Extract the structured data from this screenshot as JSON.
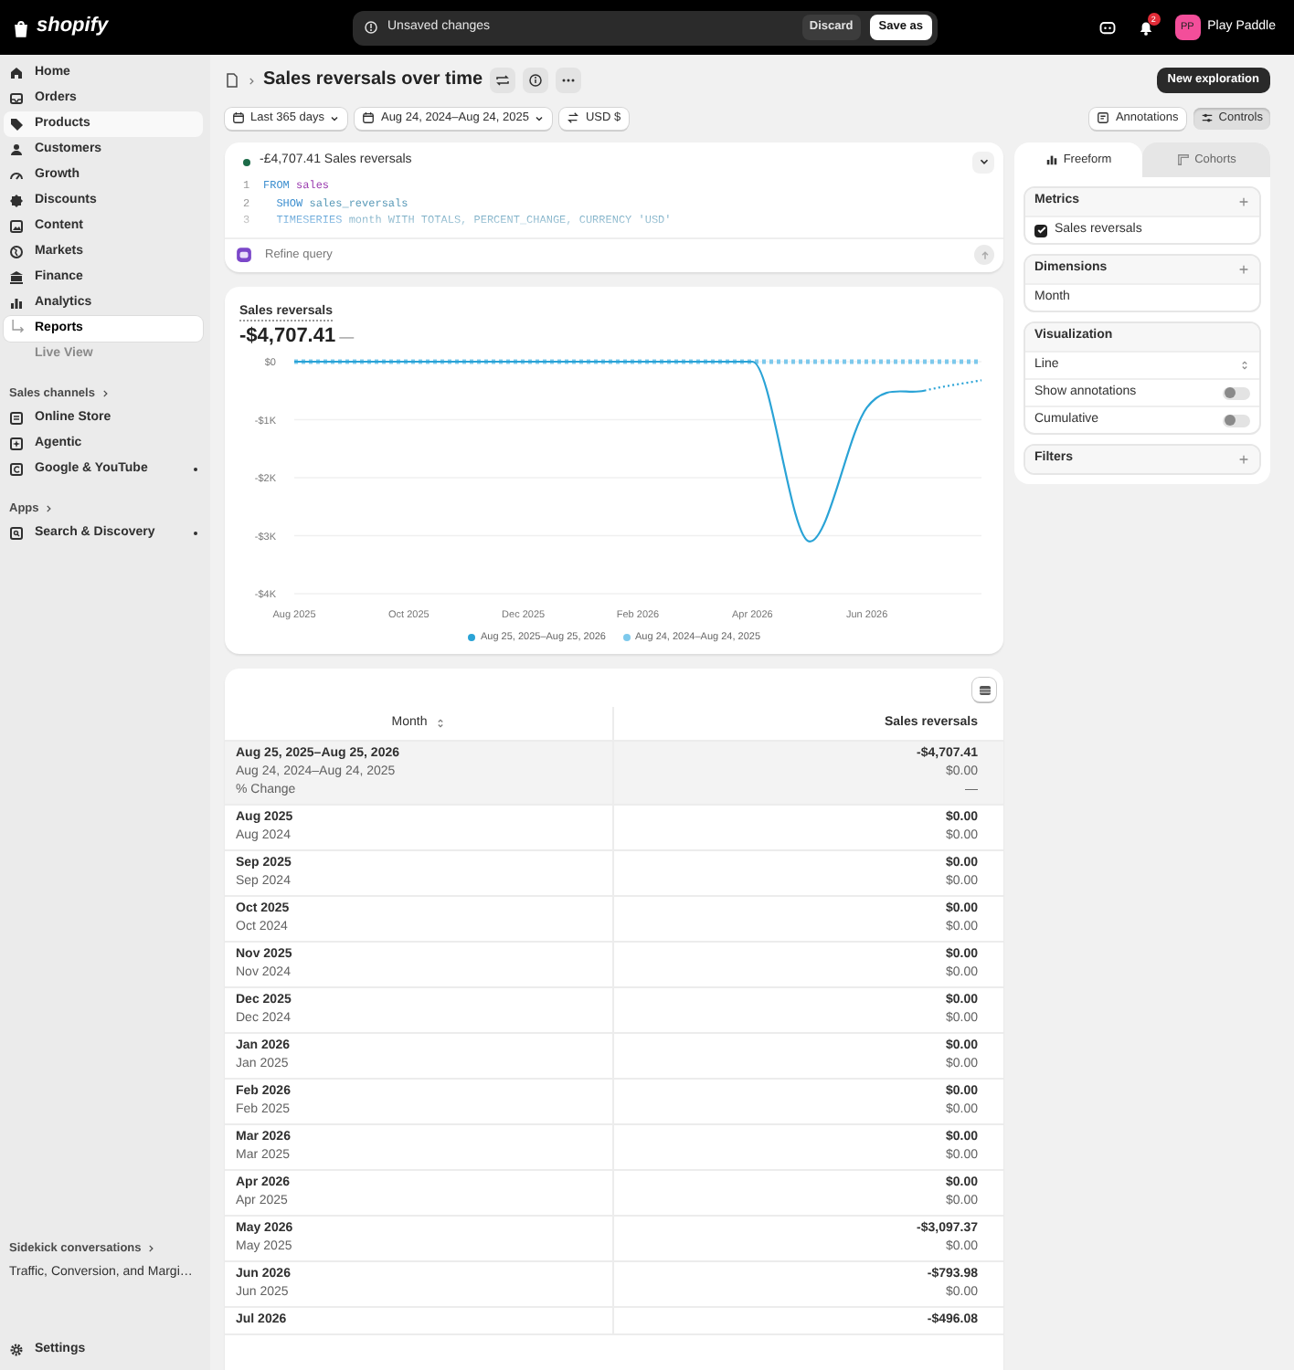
{
  "topbar": {
    "logo": "shopify",
    "alert": "Unsaved changes",
    "discard": "Discard",
    "save": "Save as",
    "notification_count": "2",
    "avatar_initials": "PP",
    "store_name": "Play Paddle"
  },
  "sidebar": {
    "items": [
      {
        "label": "Home",
        "selected": false,
        "highlighted": false
      },
      {
        "label": "Orders",
        "selected": false,
        "highlighted": false
      },
      {
        "label": "Products",
        "selected": false,
        "highlighted": true
      },
      {
        "label": "Customers",
        "selected": false,
        "highlighted": false
      },
      {
        "label": "Growth",
        "selected": false,
        "highlighted": false
      },
      {
        "label": "Discounts",
        "selected": false,
        "highlighted": false
      },
      {
        "label": "Content",
        "selected": false,
        "highlighted": false
      },
      {
        "label": "Markets",
        "selected": false,
        "highlighted": false
      },
      {
        "label": "Finance",
        "selected": false,
        "highlighted": false
      },
      {
        "label": "Analytics",
        "selected": false,
        "highlighted": false,
        "children": [
          {
            "label": "Reports",
            "selected": true
          },
          {
            "label": "Live View",
            "selected": false
          }
        ]
      }
    ],
    "sections": [
      {
        "title": "Sales channels",
        "items": [
          {
            "label": "Online Store",
            "dot": false
          },
          {
            "label": "Agentic",
            "dot": false
          },
          {
            "label": "Google & YouTube",
            "dot": true
          }
        ]
      },
      {
        "title": "Apps",
        "items": [
          {
            "label": "Search & Discovery",
            "dot": true
          }
        ]
      }
    ],
    "conversations": {
      "title": "Sidekick conversations",
      "items": [
        "Traffic, Conversion, and Margi…"
      ]
    },
    "settings": "Settings"
  },
  "header": {
    "title": "Sales reversals over time",
    "new_button": "New exploration",
    "filters": [
      {
        "label": "Last 365 days",
        "caret": true
      },
      {
        "label": "Aug 24, 2024–Aug 24, 2025",
        "caret": true
      },
      {
        "label": "USD $",
        "caret": false
      }
    ],
    "toggles": [
      {
        "label": "Annotations",
        "selected": false
      },
      {
        "label": "Controls",
        "selected": true
      }
    ]
  },
  "query": {
    "summary": "-£4,707.41 Sales reversals",
    "refine_placeholder": "Refine query",
    "code": [
      {
        "number": "1",
        "keyword": "FROM",
        "rest": "sales"
      },
      {
        "number": "2",
        "keyword": "  SHOW",
        "rest": "sales_reversals"
      },
      {
        "number": "3",
        "keyword": "  TIMESERIES",
        "rest": "month WITH TOTALS, PERCENT_CHANGE, CURRENCY 'USD'"
      }
    ]
  },
  "chart_card": {
    "title": "Sales reversals",
    "total": "-$4,707.41",
    "change": "—",
    "chart_data": {
      "type": "line",
      "categories": [
        "Aug 2025",
        null,
        "Oct 2025",
        null,
        "Dec 2025",
        null,
        "Feb 2026",
        null,
        "Apr 2026",
        null,
        "Jun 2026",
        null,
        null
      ],
      "ylim": [
        -4000,
        0
      ],
      "grid": true,
      "yticks": [
        {
          "value": 0,
          "label": "$0"
        },
        {
          "value": -1000,
          "label": "-$1K"
        },
        {
          "value": -2000,
          "label": "-$2K"
        },
        {
          "value": -3000,
          "label": "-$3K"
        },
        {
          "value": -4000,
          "label": "-$4K"
        }
      ],
      "series": [
        {
          "name": "Aug 25, 2025–Aug 25, 2026",
          "color": "#2aa3d6",
          "line_style": "solid_then_dotted",
          "values": [
            0,
            0,
            0,
            0,
            0,
            0,
            0,
            0,
            0,
            -3100,
            -790,
            -500,
            -320
          ]
        },
        {
          "name": "Aug 24, 2024–Aug 24, 2025",
          "color": "#7dc9ec",
          "line_style": "dashed",
          "values": [
            0,
            0,
            0,
            0,
            0,
            0,
            0,
            0,
            0,
            0,
            0,
            0,
            0
          ]
        }
      ]
    }
  },
  "panel": {
    "tabs": [
      {
        "label": "Freeform",
        "selected": true
      },
      {
        "label": "Cohorts",
        "selected": false
      }
    ],
    "metrics": {
      "title": "Metrics",
      "items": [
        {
          "label": "Sales reversals",
          "checked": true
        }
      ]
    },
    "dimensions": {
      "title": "Dimensions",
      "items": [
        "Month"
      ]
    },
    "visualization": {
      "title": "Visualization",
      "type": "Line",
      "toggles": [
        {
          "label": "Show annotations",
          "on": false
        },
        {
          "label": "Cumulative",
          "on": false
        }
      ]
    },
    "filters": {
      "title": "Filters"
    }
  },
  "table": {
    "columns": [
      "Month",
      "Sales reversals"
    ],
    "summary": {
      "current_range": "Aug 25, 2025–Aug 25, 2026",
      "previous_range": "Aug 24, 2024–Aug 24, 2025",
      "change_label": "% Change",
      "current_value": "-$4,707.41",
      "previous_value": "$0.00",
      "change_value": "—"
    },
    "rows": [
      {
        "current": "Aug 2025",
        "previous": "Aug 2024",
        "value": "$0.00",
        "previous_value": "$0.00"
      },
      {
        "current": "Sep 2025",
        "previous": "Sep 2024",
        "value": "$0.00",
        "previous_value": "$0.00"
      },
      {
        "current": "Oct 2025",
        "previous": "Oct 2024",
        "value": "$0.00",
        "previous_value": "$0.00"
      },
      {
        "current": "Nov 2025",
        "previous": "Nov 2024",
        "value": "$0.00",
        "previous_value": "$0.00"
      },
      {
        "current": "Dec 2025",
        "previous": "Dec 2024",
        "value": "$0.00",
        "previous_value": "$0.00"
      },
      {
        "current": "Jan 2026",
        "previous": "Jan 2025",
        "value": "$0.00",
        "previous_value": "$0.00"
      },
      {
        "current": "Feb 2026",
        "previous": "Feb 2025",
        "value": "$0.00",
        "previous_value": "$0.00"
      },
      {
        "current": "Mar 2026",
        "previous": "Mar 2025",
        "value": "$0.00",
        "previous_value": "$0.00"
      },
      {
        "current": "Apr 2026",
        "previous": "Apr 2025",
        "value": "$0.00",
        "previous_value": "$0.00"
      },
      {
        "current": "May 2026",
        "previous": "May 2025",
        "value": "-$3,097.37",
        "previous_value": "$0.00"
      },
      {
        "current": "Jun 2026",
        "previous": "Jun 2025",
        "value": "-$793.98",
        "previous_value": "$0.00"
      },
      {
        "current": "Jul 2026",
        "value": "-$496.08"
      }
    ]
  }
}
